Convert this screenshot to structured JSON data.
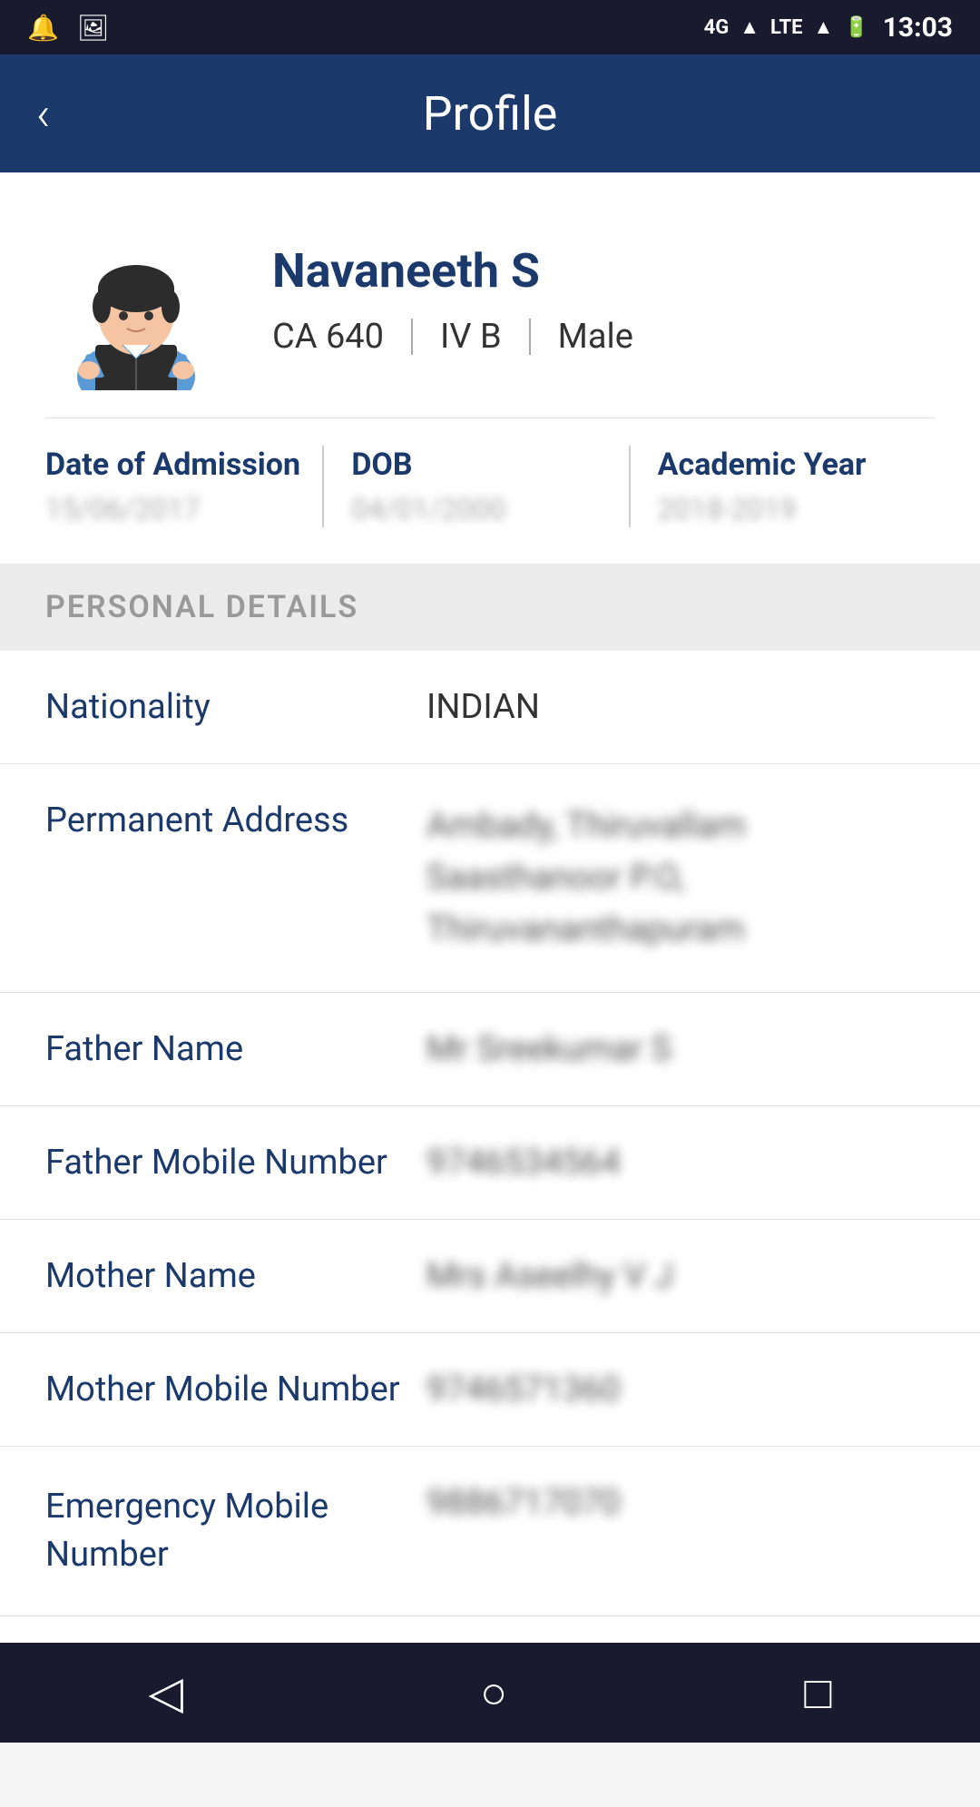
{
  "status_bar": {
    "time": "13:03",
    "signal": "4G",
    "lte": "LTE",
    "battery": "100"
  },
  "app_bar": {
    "title": "Profile",
    "back_icon": "‹"
  },
  "profile": {
    "name": "Navaneeth S",
    "roll": "CA 640",
    "section": "IV B",
    "gender": "Male",
    "date_of_admission_label": "Date of Admission",
    "date_of_admission_value": "15/06/2017",
    "dob_label": "DOB",
    "dob_value": "04/01/2000",
    "academic_year_label": "Academic Year",
    "academic_year_value": "2018-2019"
  },
  "sections": {
    "personal_details": "PERSONAL DETAILS"
  },
  "personal_details": {
    "nationality_label": "Nationality",
    "nationality_value": "INDIAN",
    "permanent_address_label": "Permanent Address",
    "permanent_address_value": "Ambady, Thiruvallam\nSaasthanoor P.O,\nThiruvananthapuram",
    "father_name_label": "Father Name",
    "father_name_value": "Mr Sreekumar S",
    "father_mobile_label": "Father Mobile Number",
    "father_mobile_value": "9746534564",
    "mother_name_label": "Mother Name",
    "mother_name_value": "Mrs Aseelhy V J",
    "mother_mobile_label": "Mother Mobile Number",
    "mother_mobile_value": "9746571360",
    "emergency_mobile_label": "Emergency Mobile Number",
    "emergency_mobile_value": "9886717070"
  },
  "nav": {
    "back_icon": "◁",
    "home_icon": "○",
    "recent_icon": "□"
  }
}
